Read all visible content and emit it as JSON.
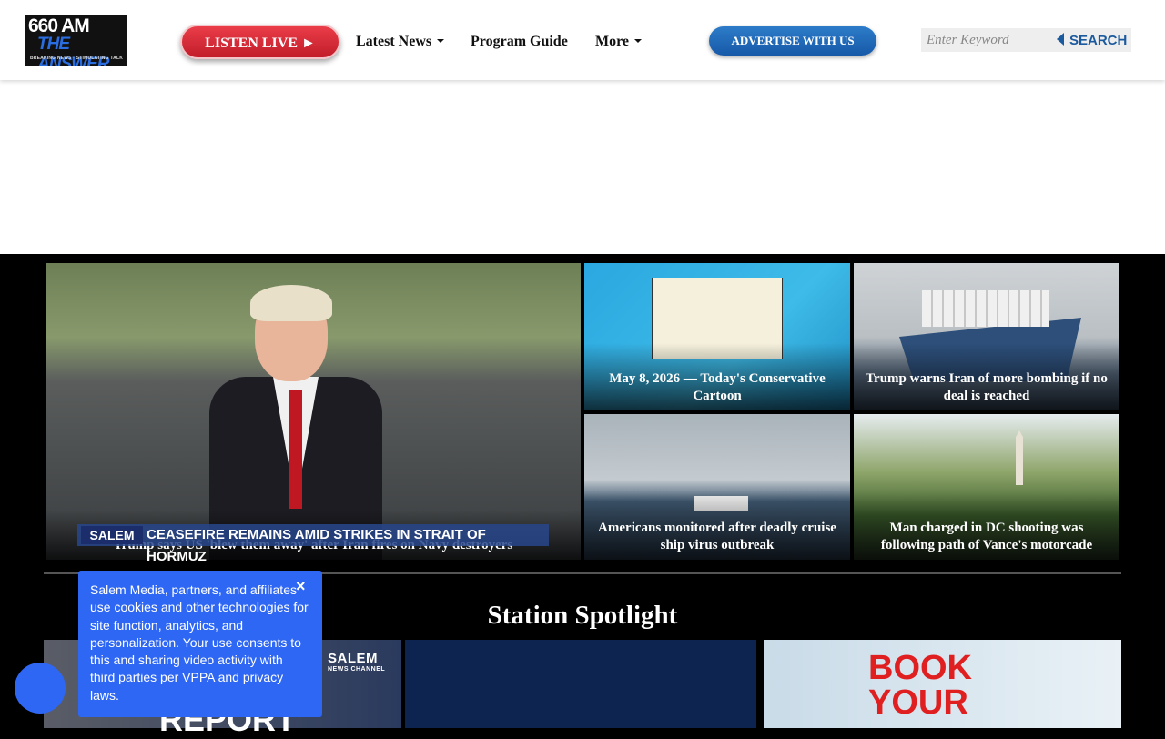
{
  "header": {
    "logo": {
      "line1": "660 AM",
      "line2": "THE ANSWER",
      "line3": "BREAKING NEWS · STIMULATING TALK"
    },
    "listen_live": "LISTEN LIVE ►",
    "nav": [
      {
        "label": "Latest News",
        "dropdown": true
      },
      {
        "label": "Program Guide",
        "dropdown": false
      },
      {
        "label": "More",
        "dropdown": true
      }
    ],
    "advertise": "ADVERTISE WITH US",
    "search": {
      "placeholder": "Enter Keyword",
      "button": "SEARCH"
    }
  },
  "featured": {
    "main": {
      "caption": "Trump says US 'blew them away' after Iran fires on Navy destroyers",
      "banner_tag": "SALEM",
      "banner_text": "CEASEFIRE REMAINS AMID STRIKES IN STRAIT OF HORMUZ"
    },
    "tiles": [
      {
        "caption": "May 8, 2026 — Today's Conservative Cartoon"
      },
      {
        "caption": "Trump warns Iran of more bombing if no deal is reached"
      },
      {
        "caption": "Americans monitored after deadly cruise ship virus outbreak"
      },
      {
        "caption": "Man charged in DC shooting was following path of Vance's motorcade"
      }
    ]
  },
  "spotlight": {
    "title": "Station Spotlight",
    "card1": {
      "brand": "SALEM",
      "brand_sub": "NEWS CHANNEL",
      "text": "REPORT"
    },
    "card3": {
      "text_line1": "BOOK",
      "text_line2": "YOUR"
    }
  },
  "cookie": {
    "text": "Salem Media, partners, and affiliates use cookies and other technologies for site function, analytics, and personalization. Your use consents to this and sharing video activity with third parties per VPPA and privacy laws.",
    "close": "×"
  },
  "colors": {
    "listen": "#d62a37",
    "advertise": "#1f6cb8",
    "cookie": "#2f67f5"
  }
}
